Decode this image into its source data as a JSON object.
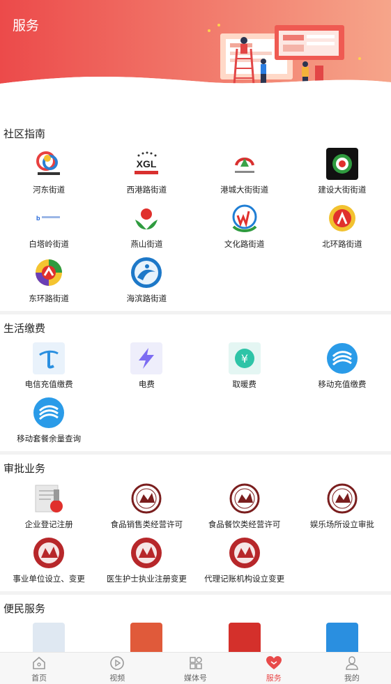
{
  "header": {
    "title": "服务"
  },
  "sections": [
    {
      "title": "社区指南",
      "items": [
        {
          "label": "河东街道",
          "icon": "hedong-logo-icon"
        },
        {
          "label": "西港路街道",
          "icon": "xgl-logo-icon"
        },
        {
          "label": "港城大街街道",
          "icon": "gangcheng-logo-icon"
        },
        {
          "label": "建设大街街道",
          "icon": "jianshe-logo-icon"
        },
        {
          "label": "白塔岭街道",
          "icon": "baitaling-logo-icon"
        },
        {
          "label": "燕山街道",
          "icon": "yanshan-logo-icon"
        },
        {
          "label": "文化路街道",
          "icon": "wenhua-logo-icon"
        },
        {
          "label": "北环路街道",
          "icon": "beihuan-logo-icon"
        },
        {
          "label": "东环路街道",
          "icon": "donghuan-logo-icon"
        },
        {
          "label": "海滨路街道",
          "icon": "haibin-logo-icon"
        }
      ]
    },
    {
      "title": "生活缴费",
      "items": [
        {
          "label": "电信充值缴费",
          "icon": "telecom-icon"
        },
        {
          "label": "电费",
          "icon": "lightning-icon"
        },
        {
          "label": "取暖费",
          "icon": "heating-fee-icon"
        },
        {
          "label": "移动充值缴费",
          "icon": "china-mobile-icon"
        },
        {
          "label": "移动套餐余量查询",
          "icon": "china-mobile-icon"
        }
      ]
    },
    {
      "title": "审批业务",
      "items": [
        {
          "label": "企业登记注册",
          "icon": "document-stamp-icon"
        },
        {
          "label": "食品销售类经营许可",
          "icon": "seal-icon"
        },
        {
          "label": "食品餐饮类经营许可",
          "icon": "seal-icon"
        },
        {
          "label": "娱乐场所设立审批",
          "icon": "seal-icon"
        },
        {
          "label": "事业单位设立、变更",
          "icon": "red-seal-icon"
        },
        {
          "label": "医生护士执业注册变更",
          "icon": "red-seal-icon"
        },
        {
          "label": "代理记账机构设立变更",
          "icon": "red-seal-icon"
        }
      ]
    },
    {
      "title": "便民服务",
      "items": []
    }
  ],
  "tabbar": [
    {
      "label": "首页",
      "icon": "home-icon",
      "active": false
    },
    {
      "label": "视频",
      "icon": "play-icon",
      "active": false
    },
    {
      "label": "媒体号",
      "icon": "grid-icon",
      "active": false
    },
    {
      "label": "服务",
      "icon": "heart-icon",
      "active": true
    },
    {
      "label": "我的",
      "icon": "user-icon",
      "active": false
    }
  ],
  "colors": {
    "accent": "#e84a4a",
    "banner_start": "#ec4a4a",
    "banner_end": "#f6a58a"
  }
}
